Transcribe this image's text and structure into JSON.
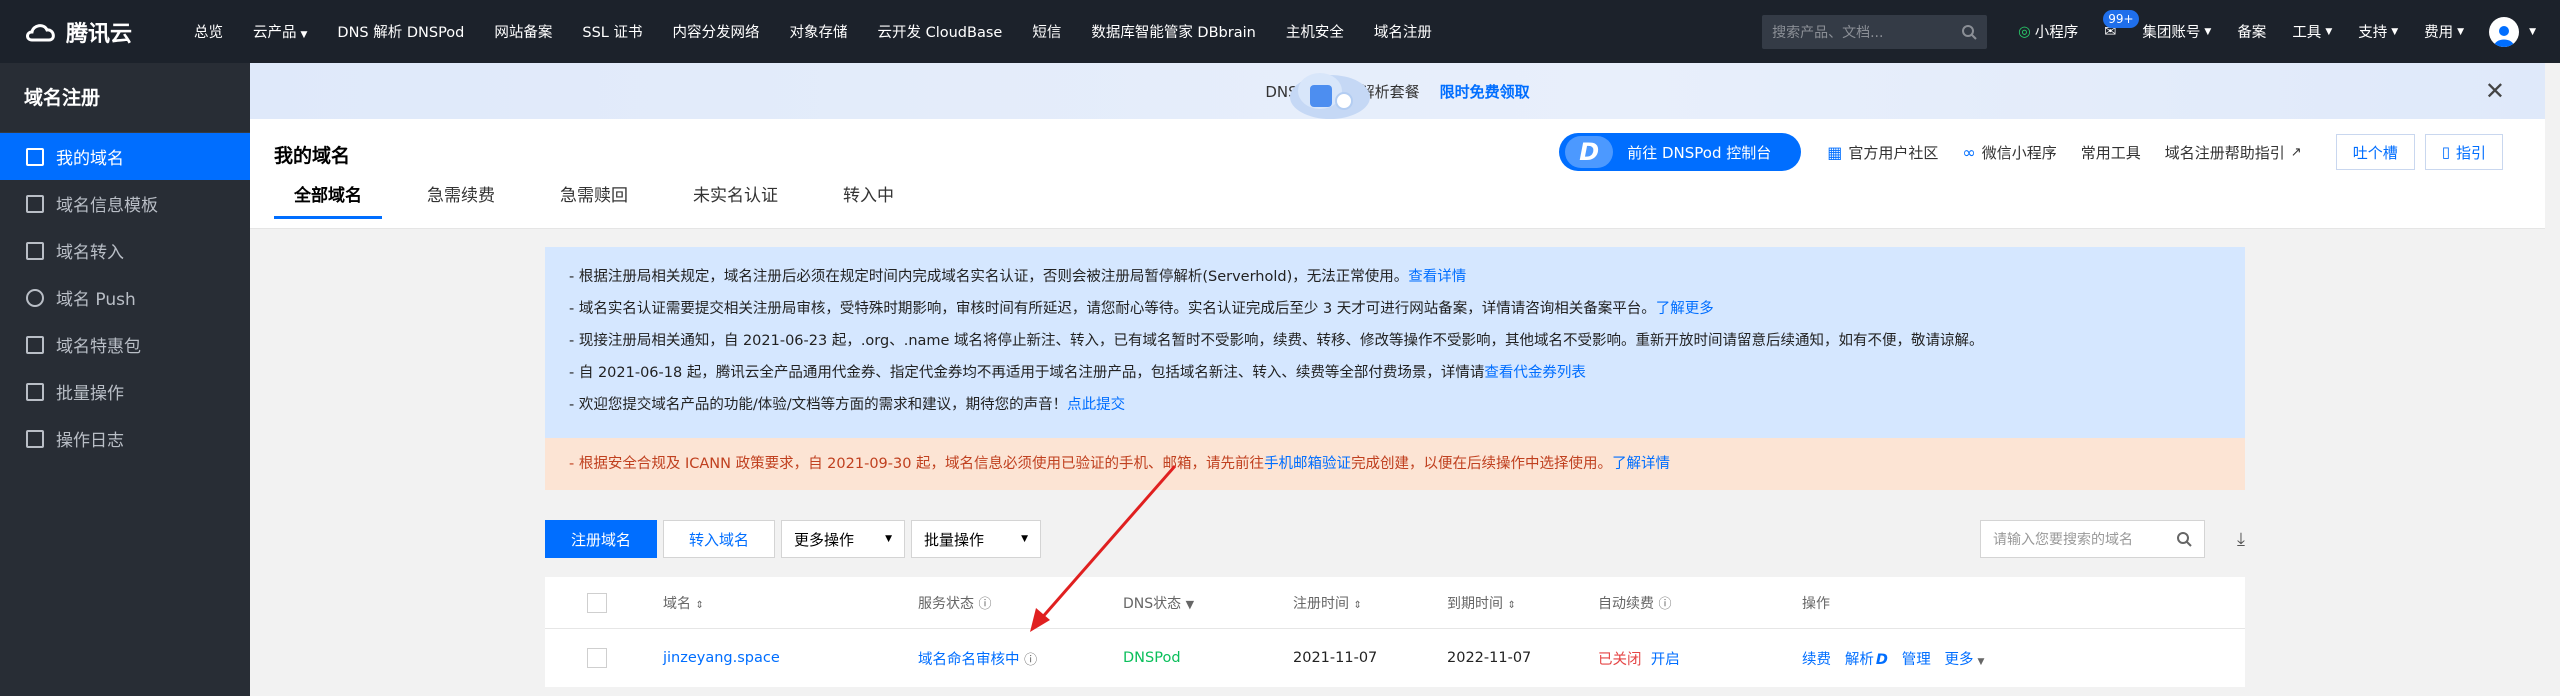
{
  "topbar": {
    "logo_text": "腾讯云",
    "nav": [
      "总览",
      "云产品",
      "DNS 解析 DNSPod",
      "网站备案",
      "SSL 证书",
      "内容分发网络",
      "对象存储",
      "云开发 CloudBase",
      "短信",
      "数据库智能管家 DBbrain",
      "主机安全",
      "域名注册"
    ],
    "search_placeholder": "搜索产品、文档...",
    "mini_program": "小程序",
    "mail_badge": "99+",
    "group_account": "集团账号",
    "beian": "备案",
    "tools": "工具",
    "support": "支持",
    "fees": "费用"
  },
  "sidebar": {
    "title": "域名注册",
    "items": [
      {
        "label": "我的域名",
        "active": true
      },
      {
        "label": "域名信息模板"
      },
      {
        "label": "域名转入"
      },
      {
        "label": "域名 Push"
      },
      {
        "label": "域名特惠包"
      },
      {
        "label": "批量操作"
      },
      {
        "label": "操作日志"
      }
    ]
  },
  "banner": {
    "text": "DNSPod 全新解析套餐",
    "highlight": "限时免费领取"
  },
  "header": {
    "title": "我的域名",
    "tabs": [
      "全部域名",
      "急需续费",
      "急需赎回",
      "未实名认证",
      "转入中"
    ],
    "dns_button": "前往 DNSPod 控制台",
    "dns_logo": "D",
    "links": [
      "官方用户社区",
      "微信小程序",
      "常用工具",
      "域名注册帮助指引"
    ],
    "feedback": "吐个槽",
    "guide": "指引"
  },
  "notices": {
    "blue": [
      {
        "text": "- 根据注册局相关规定，域名注册后必须在规定时间内完成域名实名认证，否则会被注册局暂停解析(Serverhold)，无法正常使用。",
        "link": "查看详情"
      },
      {
        "text": "- 域名实名认证需要提交相关注册局审核，受特殊时期影响，审核时间有所延迟，请您耐心等待。实名认证完成后至少 3 天才可进行网站备案，详情请咨询相关备案平台。",
        "link": "了解更多"
      },
      {
        "text": "- 现接注册局相关通知，自 2021-06-23 起，.org、.name 域名将停止新注、转入，已有域名暂时不受影响，续费、转移、修改等操作不受影响，其他域名不受影响。重新开放时间请留意后续通知，如有不便，敬请谅解。",
        "link": ""
      },
      {
        "text": "- 自 2021-06-18 起，腾讯云全产品通用代金券、指定代金券均不再适用于域名注册产品，包括域名新注、转入、续费等全部付费场景，详情请",
        "link": "查看代金券列表"
      },
      {
        "text": "- 欢迎您提交域名产品的功能/体验/文档等方面的需求和建议，期待您的声音！",
        "link": "点此提交"
      }
    ],
    "orange": {
      "text1": "- 根据安全合规及 ICANN 政策要求，自 2021-09-30 起，域名信息必须使用已验证的手机、邮箱，请先前往",
      "link1": "手机邮箱验证",
      "text2": "完成创建，以便在后续操作中选择使用。",
      "link2": "了解详情"
    }
  },
  "toolbar": {
    "register": "注册域名",
    "transfer_in": "转入域名",
    "more_ops": "更多操作",
    "batch_ops": "批量操作",
    "search_placeholder": "请输入您要搜索的域名"
  },
  "table": {
    "headers": [
      "域名",
      "服务状态",
      "DNS状态",
      "注册时间",
      "到期时间",
      "自动续费",
      "操作"
    ],
    "rows": [
      {
        "domain": "jinzeyang.space",
        "status": "域名命名审核中",
        "dns": "DNSPod",
        "registered": "2021-11-07",
        "expires": "2022-11-07",
        "auto_renew": "已关闭",
        "auto_renew_action": "开启",
        "actions": [
          "续费",
          "解析",
          "管理",
          "更多"
        ]
      }
    ]
  },
  "colors": {
    "accent": "#006eff",
    "topbar": "#1c222b",
    "sidebar": "#282d35",
    "arrow": "#e02020"
  }
}
